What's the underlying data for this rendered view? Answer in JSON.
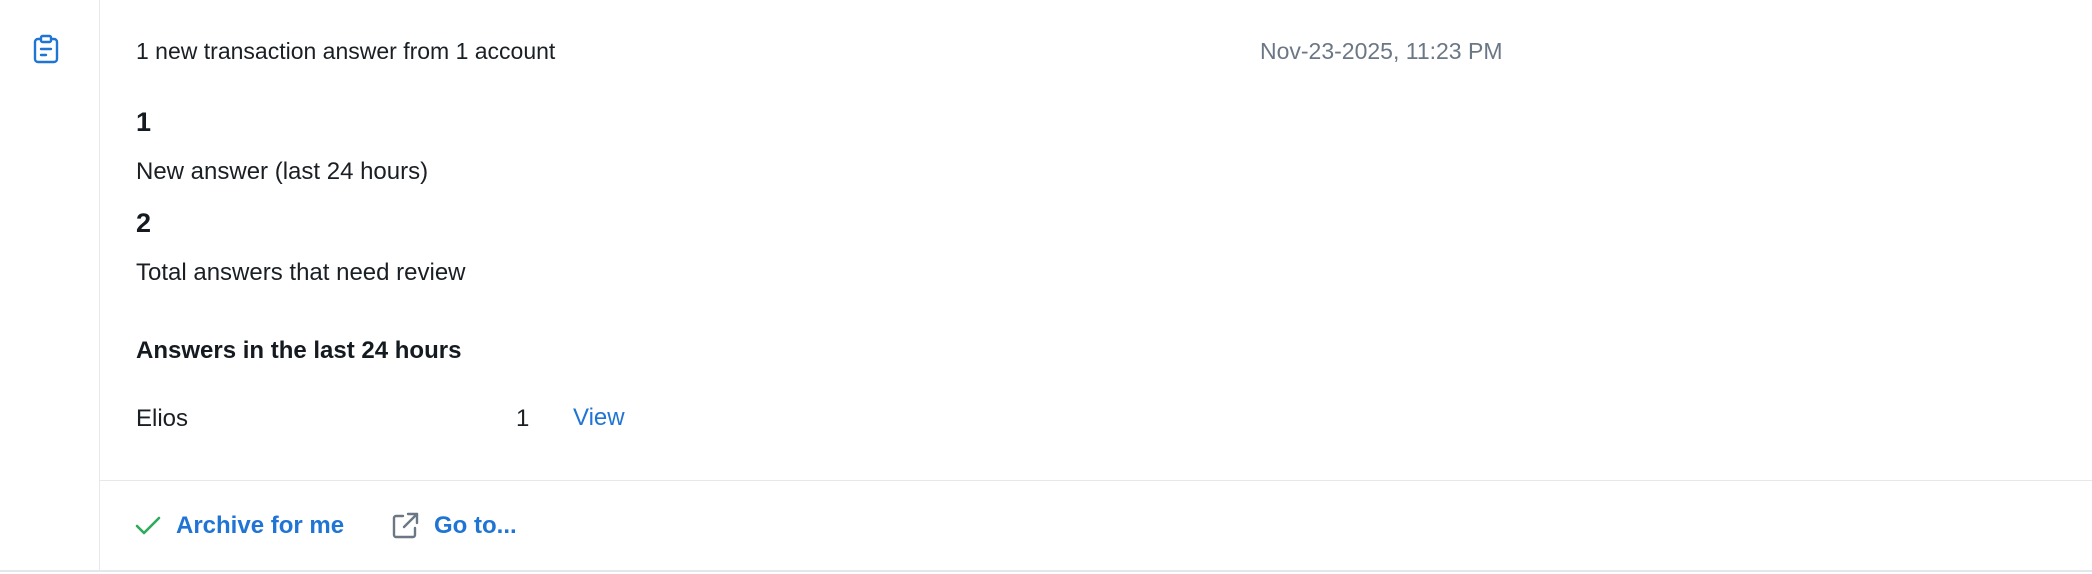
{
  "notification": {
    "icon": "clipboard-icon",
    "title": "1 new transaction answer from 1 account",
    "timestamp": "Nov-23-2025, 11:23 PM"
  },
  "stats": [
    {
      "value": "1",
      "label": "New answer (last 24 hours)"
    },
    {
      "value": "2",
      "label": "Total answers that need review"
    }
  ],
  "answers_section": {
    "title": "Answers in the last 24 hours",
    "rows": [
      {
        "name": "Elios",
        "count": "1",
        "link_label": "View"
      }
    ]
  },
  "footer": {
    "archive_label": "Archive for me",
    "archive_icon": "checkmark-icon",
    "goto_label": "Go to...",
    "goto_icon": "external-link-icon"
  },
  "colors": {
    "accent": "#1f74d4",
    "check": "#2eaa5c",
    "muted": "#6b7785"
  }
}
